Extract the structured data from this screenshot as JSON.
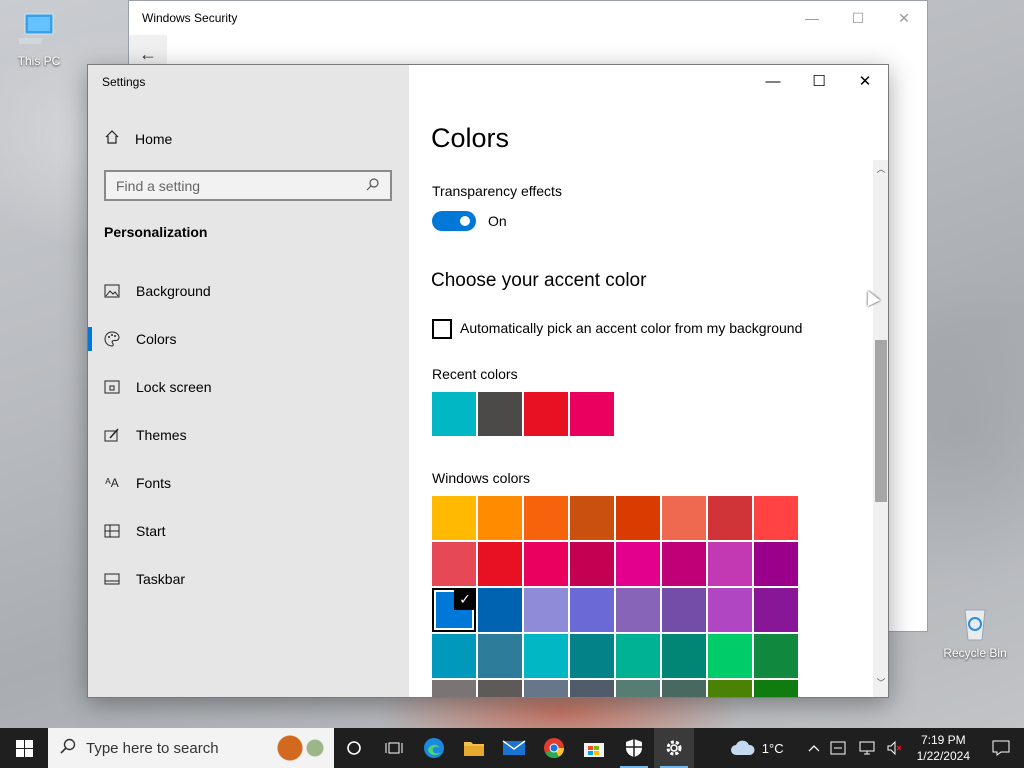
{
  "desktop": {
    "icons": [
      {
        "label": "This PC",
        "icon": "computer-icon"
      },
      {
        "label": "Recycle Bin",
        "icon": "recycle-bin-icon"
      }
    ]
  },
  "windows_security": {
    "title": "Windows Security",
    "controls": {
      "minimize": "—",
      "maximize": "☐",
      "close": "✕"
    }
  },
  "settings": {
    "title": "Settings",
    "controls": {
      "minimize": "—",
      "maximize": "☐",
      "close": "✕"
    },
    "sidebar": {
      "home_label": "Home",
      "search_placeholder": "Find a setting",
      "section": "Personalization",
      "items": [
        {
          "label": "Background",
          "icon": "picture-icon",
          "active": false
        },
        {
          "label": "Colors",
          "icon": "palette-icon",
          "active": true
        },
        {
          "label": "Lock screen",
          "icon": "lock-screen-icon",
          "active": false
        },
        {
          "label": "Themes",
          "icon": "brush-icon",
          "active": false
        },
        {
          "label": "Fonts",
          "icon": "font-icon",
          "active": false
        },
        {
          "label": "Start",
          "icon": "start-icon",
          "active": false
        },
        {
          "label": "Taskbar",
          "icon": "taskbar-icon",
          "active": false
        }
      ]
    },
    "main": {
      "page_title": "Colors",
      "transparency_label": "Transparency effects",
      "transparency_state": "On",
      "accent_heading": "Choose your accent color",
      "auto_pick_label": "Automatically pick an accent color from my background",
      "auto_pick_checked": false,
      "recent_label": "Recent colors",
      "recent_colors": [
        "#00b7c3",
        "#4c4a48",
        "#e81123",
        "#ea005e"
      ],
      "windows_colors_label": "Windows colors",
      "windows_colors": [
        [
          "#ffb900",
          "#ff8c00",
          "#f7630c",
          "#ca5010",
          "#da3b01",
          "#ef6950",
          "#d13438",
          "#ff4343"
        ],
        [
          "#e74856",
          "#e81123",
          "#ea005e",
          "#c30052",
          "#e3008c",
          "#bf0077",
          "#c239b3",
          "#9a0089"
        ],
        [
          "#0078d7",
          "#0063b1",
          "#8e8cd8",
          "#6b69d6",
          "#8764b8",
          "#744da9",
          "#b146c2",
          "#881798"
        ],
        [
          "#0099bc",
          "#2d7d9a",
          "#00b7c3",
          "#038387",
          "#00b294",
          "#018574",
          "#00cc6a",
          "#10893e"
        ],
        [
          "#7a7574",
          "#5d5a58",
          "#68768a",
          "#515c6b",
          "#567c73",
          "#486860",
          "#498205",
          "#107c10"
        ]
      ],
      "selected_color": "#0078d7"
    }
  },
  "taskbar": {
    "search_placeholder": "Type here to search",
    "apps": [
      {
        "name": "cortana",
        "icon": "cortana-icon",
        "running": false
      },
      {
        "name": "task-view",
        "icon": "task-view-icon",
        "running": false
      },
      {
        "name": "edge",
        "icon": "edge-icon",
        "running": false
      },
      {
        "name": "file-explorer",
        "icon": "folder-icon",
        "running": false
      },
      {
        "name": "mail",
        "icon": "mail-icon",
        "running": false
      },
      {
        "name": "chrome",
        "icon": "chrome-icon",
        "running": false
      },
      {
        "name": "store",
        "icon": "store-icon",
        "running": false
      },
      {
        "name": "windows-security",
        "icon": "shield-icon",
        "running": true
      },
      {
        "name": "settings",
        "icon": "gear-icon",
        "running": true
      }
    ],
    "weather": "1°C",
    "time": "7:19 PM",
    "date": "1/22/2024"
  }
}
